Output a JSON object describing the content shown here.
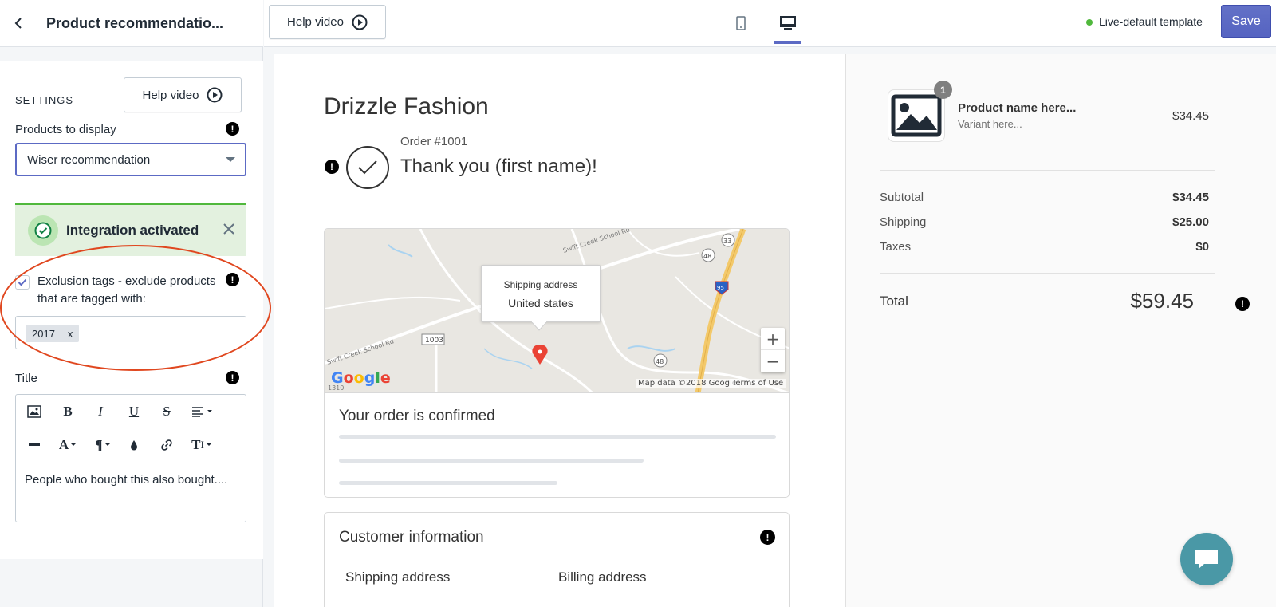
{
  "sidebar": {
    "title": "Product recommendatio...",
    "settings_label": "SETTINGS",
    "help_video_label": "Help video",
    "products_to_display_label": "Products to display",
    "products_to_display_value": "Wiser recommendation",
    "banner_text": "Integration activated",
    "exclusion_checked": true,
    "exclusion_label": "Exclusion tags - exclude products that are tagged with:",
    "tags": [
      {
        "label": "2017",
        "remove": "x"
      }
    ],
    "title_label": "Title",
    "editor_text": "People who bought this also bought...."
  },
  "topbar": {
    "help_video_label": "Help video",
    "status_text": "Live-default template",
    "save_label": "Save",
    "active_device": "desktop"
  },
  "preview": {
    "store_name": "Drizzle Fashion",
    "order_number": "Order #1001",
    "thank_you": "Thank you (first name)!",
    "map": {
      "callout_line1": "Shipping address",
      "callout_line2": "United states",
      "road_labels": [
        "Swift Creek School Rd",
        "Swift Creek School Rd",
        "1003",
        "48",
        "48",
        "33",
        "95"
      ],
      "zoom_in": "+",
      "zoom_out": "−",
      "logo": "Google",
      "map_data": "Map data ©2018 Google",
      "terms": "Terms of Use",
      "legend_fragment": "1310"
    },
    "confirmed_title": "Your order is confirmed",
    "customer_info_title": "Customer information",
    "shipping_address_label": "Shipping address",
    "billing_address_label": "Billing address"
  },
  "summary": {
    "quantity": "1",
    "product_name": "Product name here...",
    "variant": "Variant here...",
    "product_price": "$34.45",
    "rows": [
      {
        "label": "Subtotal",
        "value": "$34.45"
      },
      {
        "label": "Shipping",
        "value": "$25.00"
      },
      {
        "label": "Taxes",
        "value": "$0"
      }
    ],
    "total_label": "Total",
    "total_value": "$59.45"
  },
  "info_icon_glyph": "!",
  "colors": {
    "accent": "#5c6ac4",
    "success": "#50b83c",
    "banner_bg": "#e3f1df",
    "annotation": "#e0471f",
    "chat": "#4a98a6",
    "map_pin": "#ea4335"
  },
  "icons": [
    "chevron-left-icon",
    "play-circle-icon",
    "info-icon",
    "check-circle-icon",
    "close-icon",
    "checkmark-icon",
    "image-icon",
    "bold-icon",
    "italic-icon",
    "underline-icon",
    "strikethrough-icon",
    "align-icon",
    "horizontal-rule-icon",
    "font-color-icon",
    "paragraph-icon",
    "fill-color-icon",
    "link-icon",
    "text-size-icon",
    "mobile-icon",
    "desktop-icon",
    "map-pin-icon",
    "chat-icon"
  ]
}
